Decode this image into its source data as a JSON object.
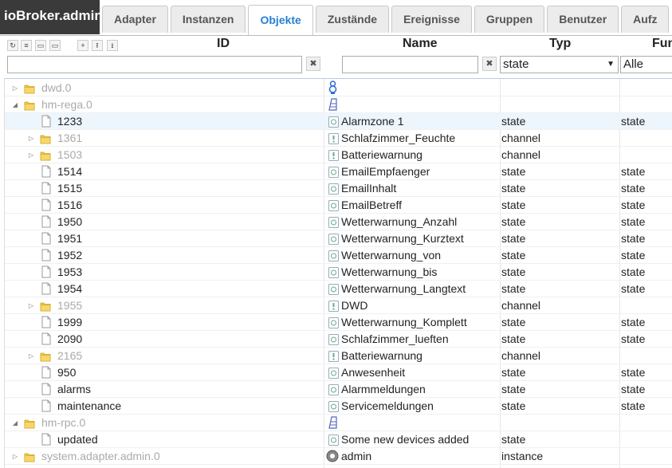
{
  "app": {
    "title": "ioBroker.admin"
  },
  "tabs": [
    {
      "label": "Adapter",
      "active": false
    },
    {
      "label": "Instanzen",
      "active": false
    },
    {
      "label": "Objekte",
      "active": true
    },
    {
      "label": "Zustände",
      "active": false
    },
    {
      "label": "Ereignisse",
      "active": false
    },
    {
      "label": "Gruppen",
      "active": false
    },
    {
      "label": "Benutzer",
      "active": false
    },
    {
      "label": "Aufz",
      "active": false
    }
  ],
  "toolbar": {
    "icons": [
      "refresh-icon",
      "list-icon",
      "folder-collapse-icon",
      "folder-expand-icon",
      "add-icon",
      "upload-icon",
      "download-icon"
    ]
  },
  "columns": {
    "id": "ID",
    "name": "Name",
    "typ": "Typ",
    "fun": "Fun"
  },
  "filters": {
    "id_value": "",
    "name_value": "",
    "typ_value": "state",
    "fun_value": "Alle",
    "clear_glyph": "✖"
  },
  "rows": [
    {
      "id": "dwd.0",
      "level": 0,
      "kind": "folder",
      "expand": "closed",
      "grey": true,
      "icon": "dwd-logo-icon",
      "name": "",
      "typ": "",
      "fun": ""
    },
    {
      "id": "hm-rega.0",
      "level": 0,
      "kind": "folder",
      "expand": "open",
      "grey": true,
      "icon": "ccu-logo-icon",
      "name": "",
      "typ": "",
      "fun": ""
    },
    {
      "id": "1233",
      "level": 1,
      "kind": "file",
      "grey": false,
      "icon": "state-icon",
      "name": "Alarmzone 1",
      "typ": "state",
      "fun": "state",
      "hl": true
    },
    {
      "id": "1361",
      "level": 1,
      "kind": "folder",
      "expand": "closed",
      "grey": true,
      "icon": "channel-icon",
      "name": "Schlafzimmer_Feuchte",
      "typ": "channel",
      "fun": ""
    },
    {
      "id": "1503",
      "level": 1,
      "kind": "folder",
      "expand": "closed",
      "grey": true,
      "icon": "channel-icon",
      "name": "Batteriewarnung",
      "typ": "channel",
      "fun": ""
    },
    {
      "id": "1514",
      "level": 1,
      "kind": "file",
      "grey": false,
      "icon": "state-icon",
      "name": "EmailEmpfaenger",
      "typ": "state",
      "fun": "state"
    },
    {
      "id": "1515",
      "level": 1,
      "kind": "file",
      "grey": false,
      "icon": "state-icon",
      "name": "EmailInhalt",
      "typ": "state",
      "fun": "state"
    },
    {
      "id": "1516",
      "level": 1,
      "kind": "file",
      "grey": false,
      "icon": "state-icon",
      "name": "EmailBetreff",
      "typ": "state",
      "fun": "state"
    },
    {
      "id": "1950",
      "level": 1,
      "kind": "file",
      "grey": false,
      "icon": "state-icon",
      "name": "Wetterwarnung_Anzahl",
      "typ": "state",
      "fun": "state"
    },
    {
      "id": "1951",
      "level": 1,
      "kind": "file",
      "grey": false,
      "icon": "state-icon",
      "name": "Wetterwarnung_Kurztext",
      "typ": "state",
      "fun": "state"
    },
    {
      "id": "1952",
      "level": 1,
      "kind": "file",
      "grey": false,
      "icon": "state-icon",
      "name": "Wetterwarnung_von",
      "typ": "state",
      "fun": "state"
    },
    {
      "id": "1953",
      "level": 1,
      "kind": "file",
      "grey": false,
      "icon": "state-icon",
      "name": "Wetterwarnung_bis",
      "typ": "state",
      "fun": "state"
    },
    {
      "id": "1954",
      "level": 1,
      "kind": "file",
      "grey": false,
      "icon": "state-icon",
      "name": "Wetterwarnung_Langtext",
      "typ": "state",
      "fun": "state"
    },
    {
      "id": "1955",
      "level": 1,
      "kind": "folder",
      "expand": "closed",
      "grey": true,
      "icon": "channel-icon",
      "name": "DWD",
      "typ": "channel",
      "fun": ""
    },
    {
      "id": "1999",
      "level": 1,
      "kind": "file",
      "grey": false,
      "icon": "state-icon",
      "name": "Wetterwarnung_Komplett",
      "typ": "state",
      "fun": "state"
    },
    {
      "id": "2090",
      "level": 1,
      "kind": "file",
      "grey": false,
      "icon": "state-icon",
      "name": "Schlafzimmer_lueften",
      "typ": "state",
      "fun": "state"
    },
    {
      "id": "2165",
      "level": 1,
      "kind": "folder",
      "expand": "closed",
      "grey": true,
      "icon": "channel-icon",
      "name": "Batteriewarnung",
      "typ": "channel",
      "fun": ""
    },
    {
      "id": "950",
      "level": 1,
      "kind": "file",
      "grey": false,
      "icon": "state-icon",
      "name": "Anwesenheit",
      "typ": "state",
      "fun": "state"
    },
    {
      "id": "alarms",
      "level": 1,
      "kind": "file",
      "grey": false,
      "icon": "state-icon",
      "name": "Alarmmeldungen",
      "typ": "state",
      "fun": "state"
    },
    {
      "id": "maintenance",
      "level": 1,
      "kind": "file",
      "grey": false,
      "icon": "state-icon",
      "name": "Servicemeldungen",
      "typ": "state",
      "fun": "state"
    },
    {
      "id": "hm-rpc.0",
      "level": 0,
      "kind": "folder",
      "expand": "open",
      "grey": true,
      "icon": "ccu-logo-icon",
      "name": "",
      "typ": "",
      "fun": ""
    },
    {
      "id": "updated",
      "level": 1,
      "kind": "file",
      "grey": false,
      "icon": "state-icon",
      "name": "Some new devices added",
      "typ": "state",
      "fun": ""
    },
    {
      "id": "system.adapter.admin.0",
      "level": 0,
      "kind": "folder",
      "expand": "closed",
      "grey": true,
      "icon": "gear-icon",
      "name": "admin",
      "typ": "instance",
      "fun": ""
    }
  ],
  "colors": {
    "active_tab": "#2780d4",
    "brand_bg": "#3a3a3a",
    "folder": "#f2c94c",
    "highlight": "#eef6fd"
  }
}
